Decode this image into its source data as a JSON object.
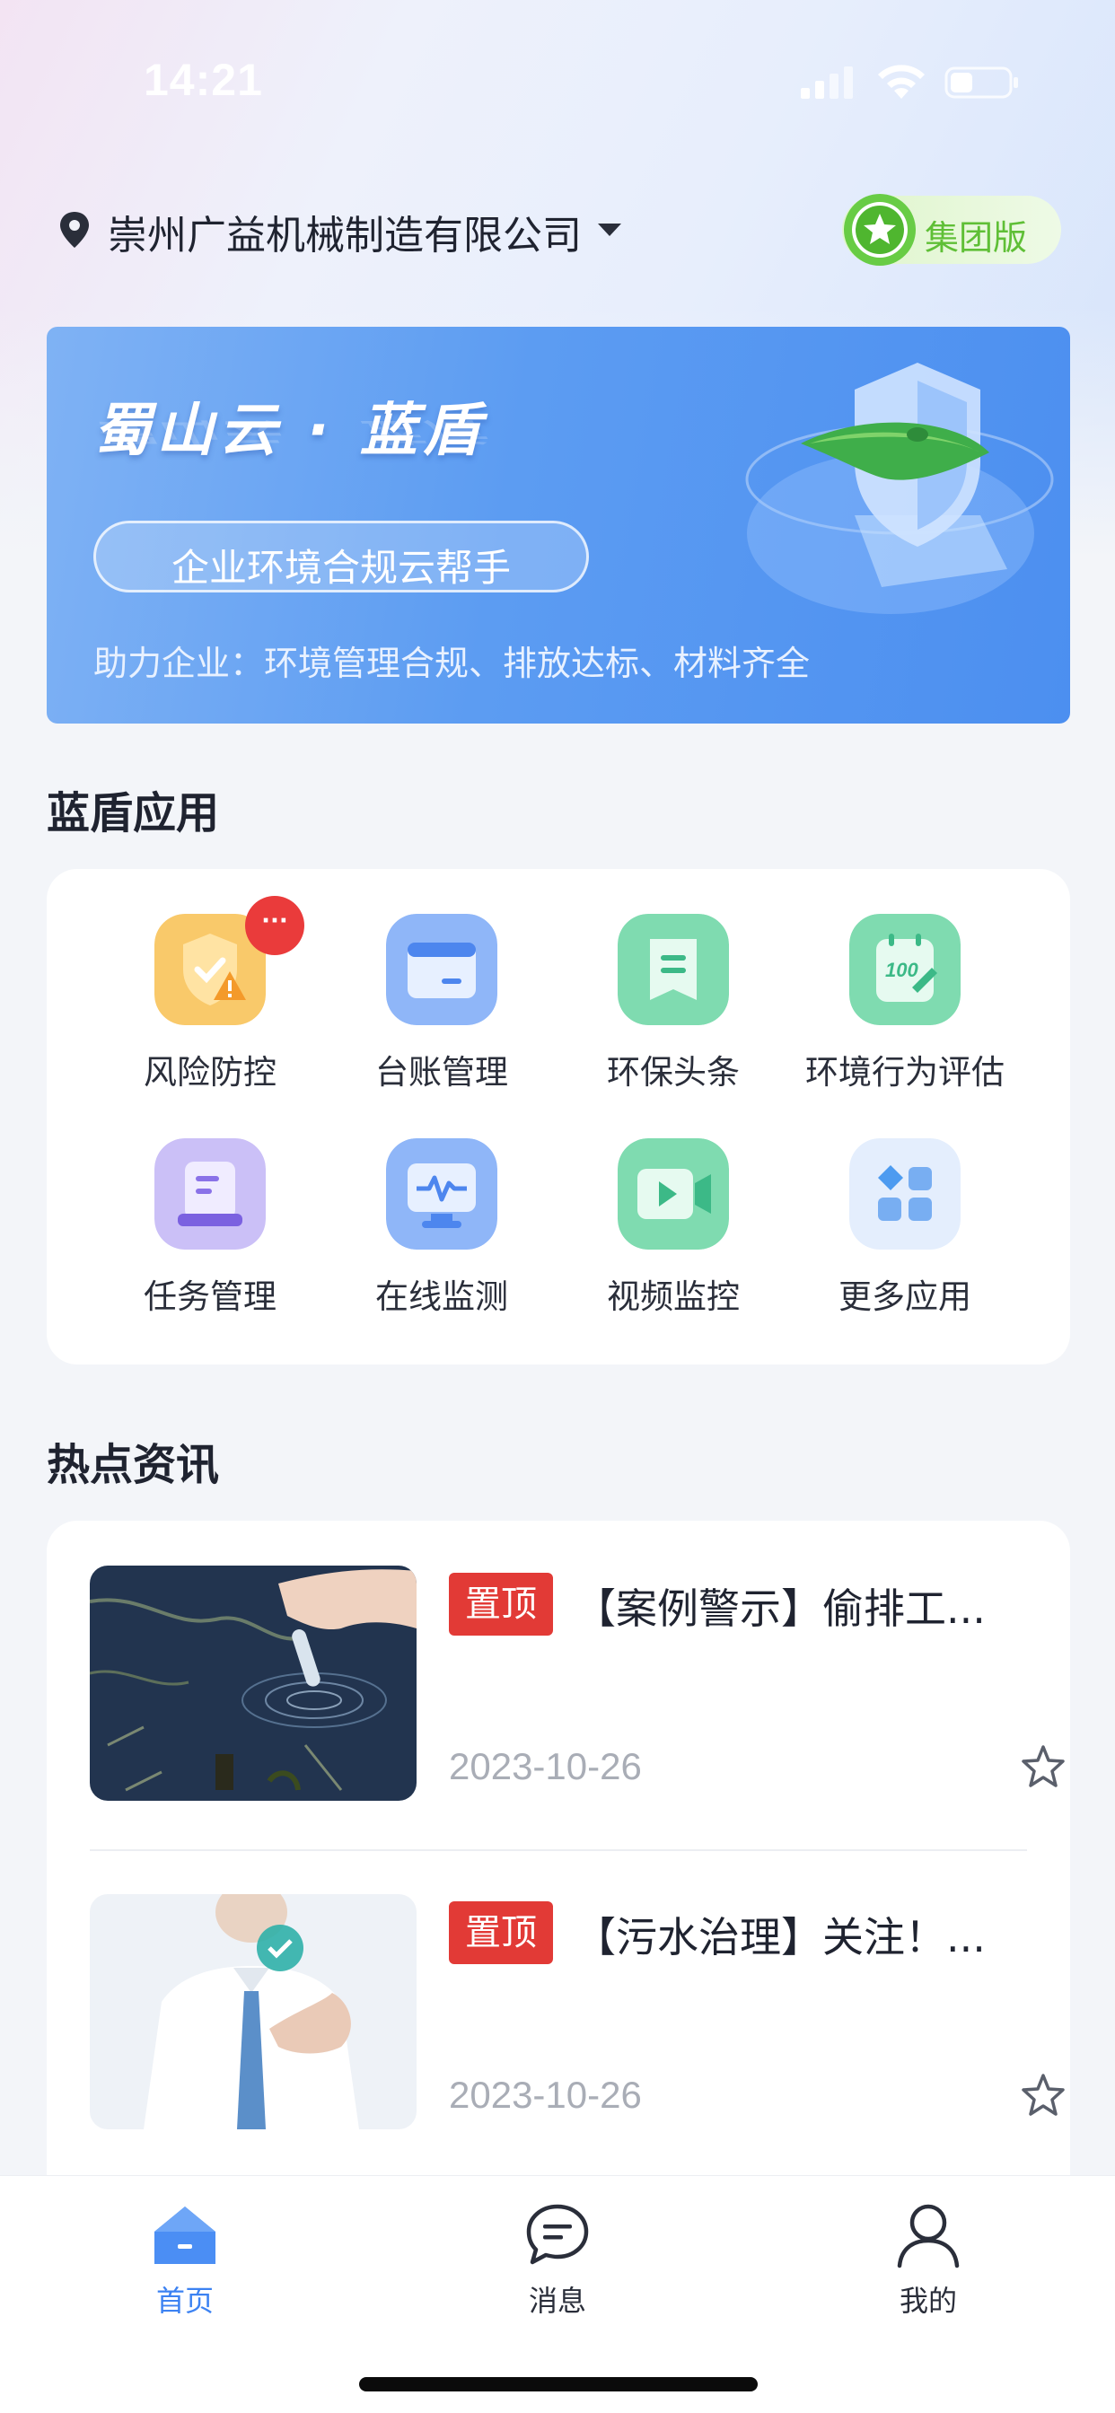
{
  "status_bar": {
    "time": "14:21"
  },
  "header": {
    "company": "崇州广益机械制造有限公司",
    "edition_badge": "集团版"
  },
  "banner": {
    "title": "蜀山云 · 蓝盾",
    "pill": "企业环境合规云帮手",
    "subtitle": "助力企业：环境管理合规、排放达标、材料齐全"
  },
  "apps_section": {
    "title": "蓝盾应用",
    "items": [
      {
        "label": "风险防控",
        "icon": "shield-warning-icon",
        "badge": "···"
      },
      {
        "label": "台账管理",
        "icon": "ledger-icon"
      },
      {
        "label": "环保头条",
        "icon": "news-bookmark-icon"
      },
      {
        "label": "环境行为评估",
        "icon": "score-notepad-icon"
      },
      {
        "label": "任务管理",
        "icon": "task-document-icon"
      },
      {
        "label": "在线监测",
        "icon": "monitor-pulse-icon"
      },
      {
        "label": "视频监控",
        "icon": "video-camera-icon"
      },
      {
        "label": "更多应用",
        "icon": "grid-more-icon"
      }
    ]
  },
  "news_section": {
    "title": "热点资讯",
    "items": [
      {
        "pin": "置顶",
        "title": "【案例警示】偷排工...",
        "date": "2023-10-26",
        "thumb": "water-sampling-photo"
      },
      {
        "pin": "置顶",
        "title": "【污水治理】关注！...",
        "date": "2023-10-26",
        "thumb": "businessman-touch-photo"
      }
    ]
  },
  "tab_bar": {
    "tabs": [
      {
        "label": "首页",
        "icon": "home-icon",
        "active": true
      },
      {
        "label": "消息",
        "icon": "message-icon",
        "active": false
      },
      {
        "label": "我的",
        "icon": "profile-icon",
        "active": false
      }
    ]
  },
  "colors": {
    "accent": "#3c82f2",
    "pin_red": "#e23a36",
    "badge_green": "#5fbf36"
  }
}
